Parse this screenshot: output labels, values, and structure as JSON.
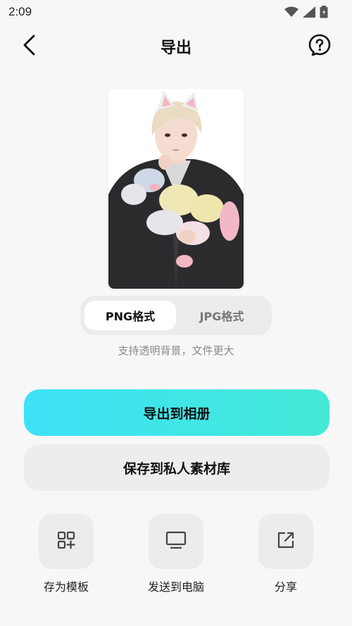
{
  "status_bar": {
    "time": "2:09"
  },
  "header": {
    "title": "导出"
  },
  "format": {
    "options": [
      "PNG格式",
      "JPG格式"
    ],
    "selected": "PNG格式",
    "hint": "支持透明背景，文件更大"
  },
  "buttons": {
    "export": "导出到相册",
    "save": "保存到私人素材库"
  },
  "actions": [
    {
      "label": "存为模板",
      "icon": "template-grid-icon"
    },
    {
      "label": "发送到电脑",
      "icon": "monitor-icon"
    },
    {
      "label": "分享",
      "icon": "share-icon"
    }
  ],
  "colors": {
    "accent_start": "#3de2f8",
    "accent_end": "#45e9d6",
    "background": "#f7f7f7"
  }
}
